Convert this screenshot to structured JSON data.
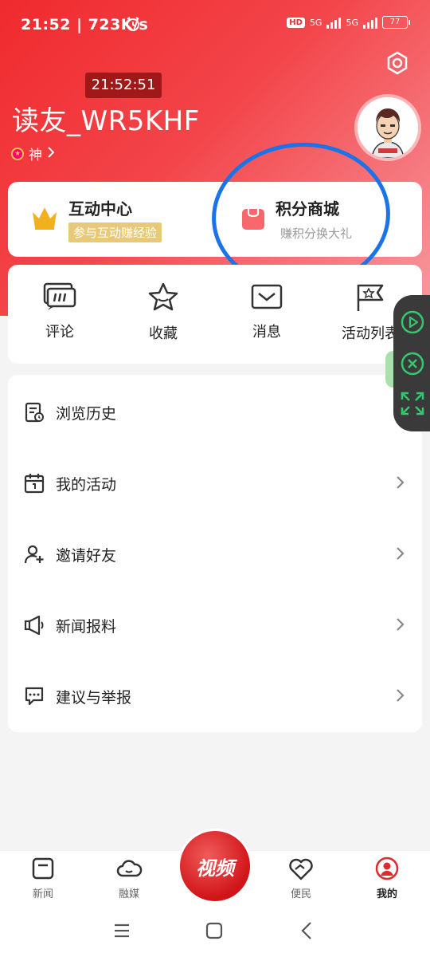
{
  "status_bar": {
    "time_speed": "21:52 | 723K/s",
    "hd": "HD",
    "net1": "5G",
    "net2": "5G",
    "battery": "77"
  },
  "overlay_time": "21:52:51",
  "profile": {
    "username": "读友_WR5KHF",
    "rank": "神"
  },
  "quick_cards": {
    "interaction": {
      "title": "互动中心",
      "tag": "参与互动赚经验"
    },
    "points_mall": {
      "title": "积分商城",
      "subtitle": "赚积分换大礼"
    }
  },
  "shortcuts": [
    "评论",
    "收藏",
    "消息",
    "活动列表"
  ],
  "menu": [
    "浏览历史",
    "我的活动",
    "邀请好友",
    "新闻报料",
    "建议与举报"
  ],
  "tabbar": {
    "news": "新闻",
    "media": "融媒",
    "video": "视频",
    "service": "便民",
    "mine": "我的"
  },
  "colors": {
    "brand": "#f02a2e",
    "annotation": "#1a73e8"
  }
}
